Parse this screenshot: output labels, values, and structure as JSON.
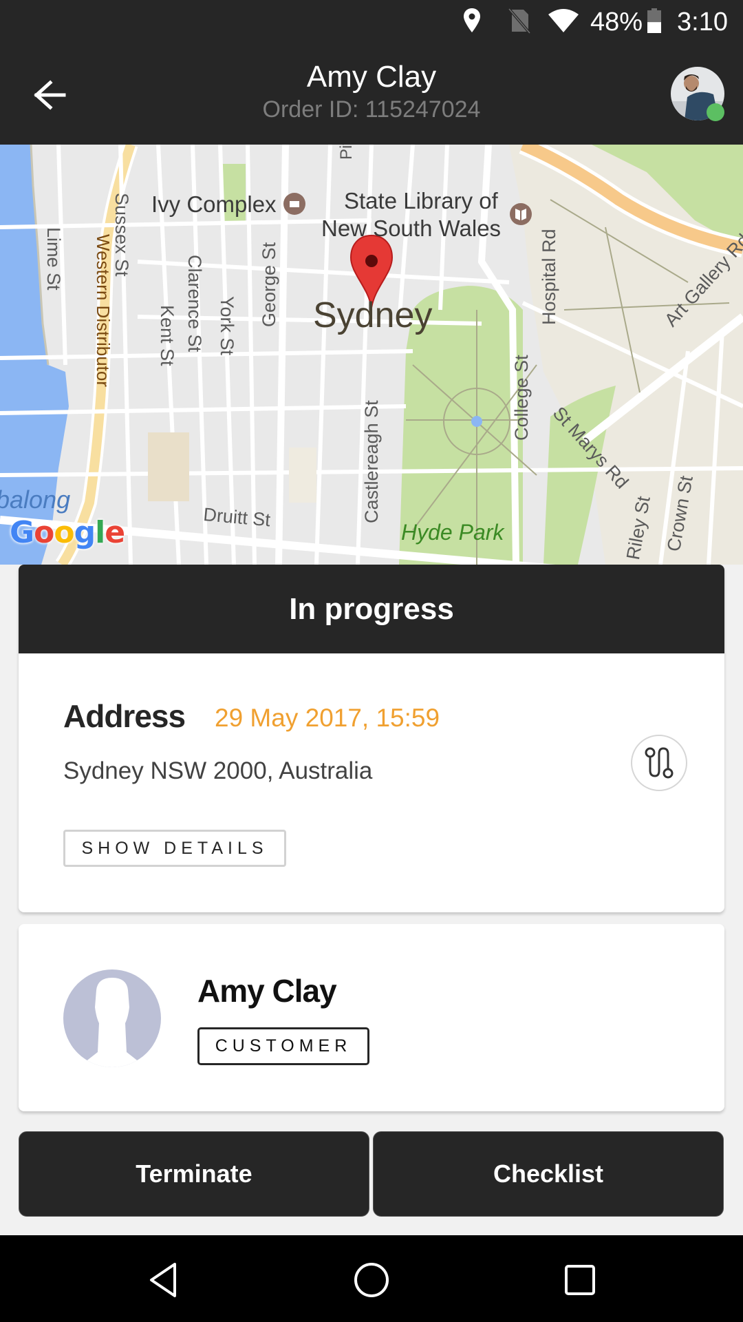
{
  "status_bar": {
    "battery_percent": "48%",
    "battery_level": 0.48,
    "time": "3:10",
    "icons": [
      "location-icon",
      "no-sim-icon",
      "wifi-icon",
      "battery-icon"
    ]
  },
  "app_bar": {
    "title": "Amy Clay",
    "subtitle": "Order ID: 115247024",
    "back_icon": "arrow-left-icon",
    "online_status_color": "#5cbf62"
  },
  "map": {
    "city": "Sydney",
    "pois": [
      "Ivy Complex",
      "State Library of",
      "New South Wales"
    ],
    "streets": [
      "Lime St",
      "Western Distributor",
      "Sussex St",
      "Kent St",
      "Clarence St",
      "York St",
      "George St",
      "Pitt St",
      "Castlereagh St",
      "College St",
      "Hospital Rd",
      "Art Gallery Rd",
      "St Marys Rd",
      "Riley St",
      "Crown St",
      "Druitt St"
    ],
    "park": "Hyde Park",
    "water": "Tumbalong",
    "provider_logo": "Google"
  },
  "order": {
    "status": "In progress",
    "address_label": "Address",
    "date": "29 May 2017, 15:59",
    "address": "Sydney NSW 2000, Australia",
    "show_details_label": "SHOW DETAILS",
    "accent_color": "#f0a030"
  },
  "customer": {
    "name": "Amy Clay",
    "role": "CUSTOMER"
  },
  "actions": {
    "terminate_label": "Terminate",
    "checklist_label": "Checklist"
  },
  "nav_bar": {
    "icons": [
      "back-triangle-icon",
      "home-circle-icon",
      "recents-square-icon"
    ]
  }
}
